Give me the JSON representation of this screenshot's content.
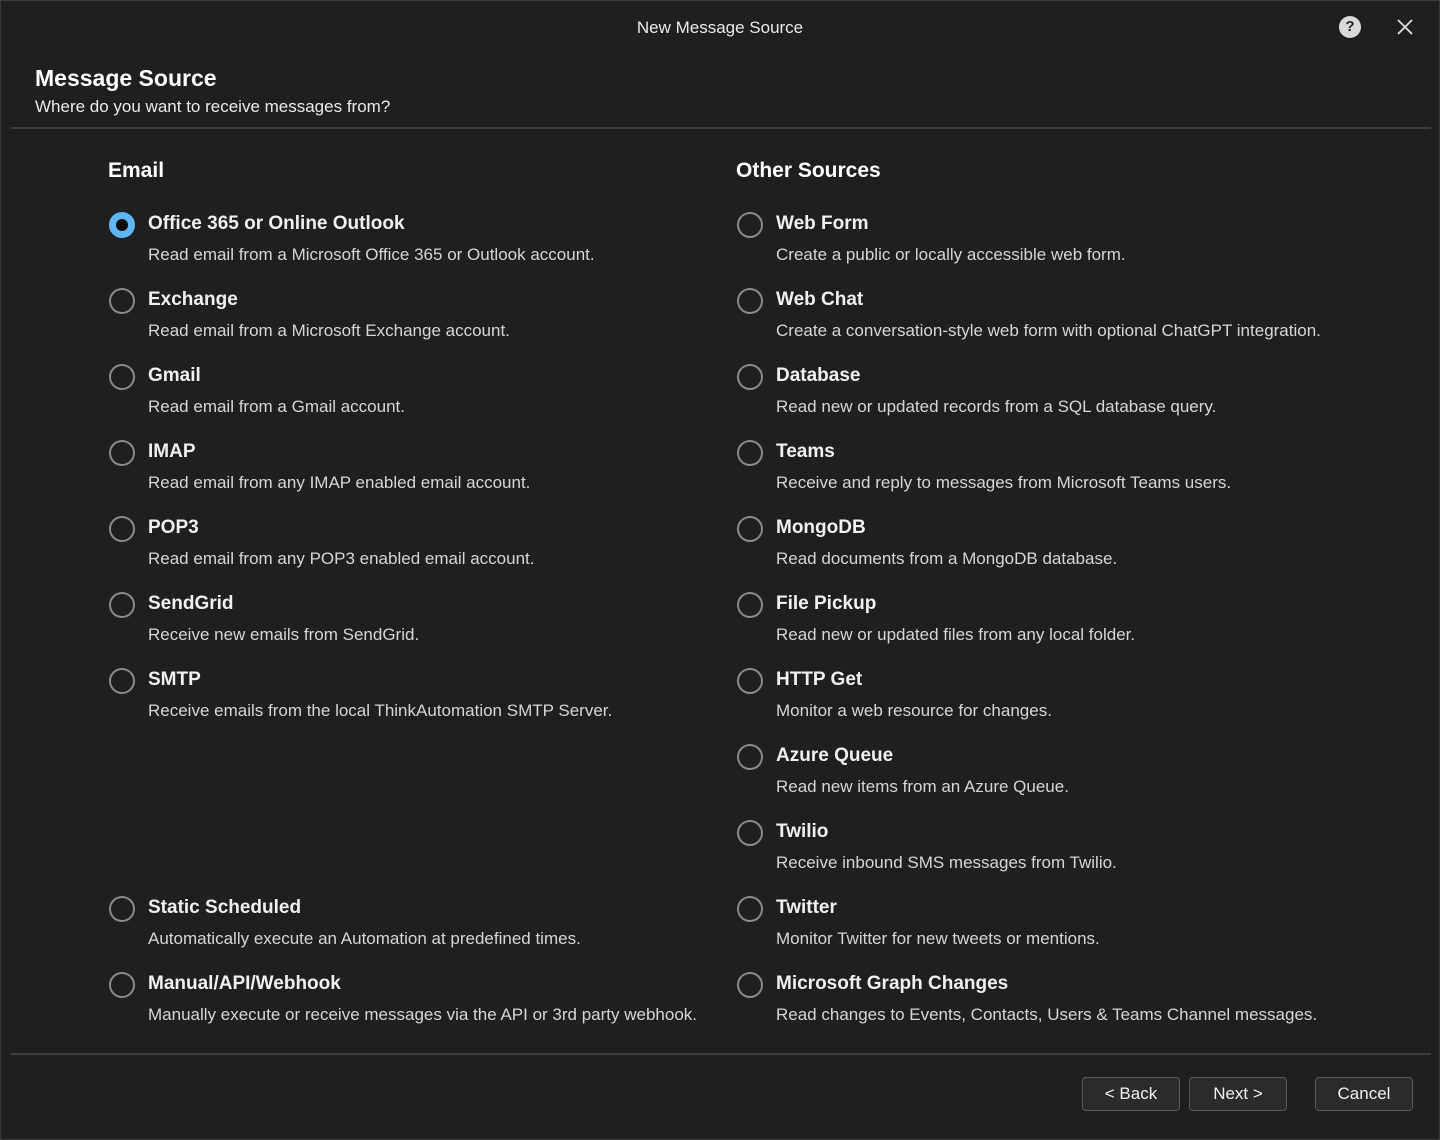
{
  "window": {
    "title": "New Message Source"
  },
  "header": {
    "title": "Message Source",
    "subtitle": "Where do you want to receive messages from?"
  },
  "email": {
    "heading": "Email",
    "options": [
      {
        "label": "Office 365 or Online Outlook",
        "desc": "Read email from a Microsoft Office 365 or Outlook account.",
        "checked": true
      },
      {
        "label": "Exchange",
        "desc": "Read email from a Microsoft Exchange account."
      },
      {
        "label": "Gmail",
        "desc": "Read email from a Gmail account."
      },
      {
        "label": "IMAP",
        "desc": "Read email from any IMAP enabled email account."
      },
      {
        "label": "POP3",
        "desc": "Read email from any POP3 enabled email account."
      },
      {
        "label": "SendGrid",
        "desc": "Receive new emails from SendGrid."
      },
      {
        "label": "SMTP",
        "desc": "Receive emails from the local ThinkAutomation SMTP Server."
      },
      {
        "label": "Static Scheduled",
        "desc": "Automatically execute an Automation at predefined times."
      },
      {
        "label": "Manual/API/Webhook",
        "desc": "Manually execute or receive messages via the API or 3rd party webhook."
      }
    ]
  },
  "other": {
    "heading": "Other Sources",
    "options": [
      {
        "label": "Web Form",
        "desc": "Create a public or locally accessible web form."
      },
      {
        "label": "Web Chat",
        "desc": "Create a conversation-style web form with optional ChatGPT integration."
      },
      {
        "label": "Database",
        "desc": "Read new or updated records from a SQL database query."
      },
      {
        "label": "Teams",
        "desc": "Receive and reply to messages from Microsoft Teams users."
      },
      {
        "label": "MongoDB",
        "desc": "Read documents from a MongoDB database."
      },
      {
        "label": "File Pickup",
        "desc": "Read new or updated files from any local folder."
      },
      {
        "label": "HTTP Get",
        "desc": "Monitor a web resource for changes."
      },
      {
        "label": "Azure Queue",
        "desc": "Read new items from an Azure Queue."
      },
      {
        "label": "Twilio",
        "desc": "Receive inbound SMS messages from Twilio."
      },
      {
        "label": "Twitter",
        "desc": "Monitor Twitter for new tweets or mentions."
      },
      {
        "label": "Microsoft Graph Changes",
        "desc": "Read changes to Events, Contacts, Users & Teams Channel messages."
      }
    ]
  },
  "buttons": {
    "back": "< Back",
    "next": "Next >",
    "cancel": "Cancel"
  },
  "icons": {
    "help": "help-icon",
    "close": "close-icon"
  },
  "colors": {
    "accent": "#5fb6f3",
    "background": "#1f1f1f"
  }
}
